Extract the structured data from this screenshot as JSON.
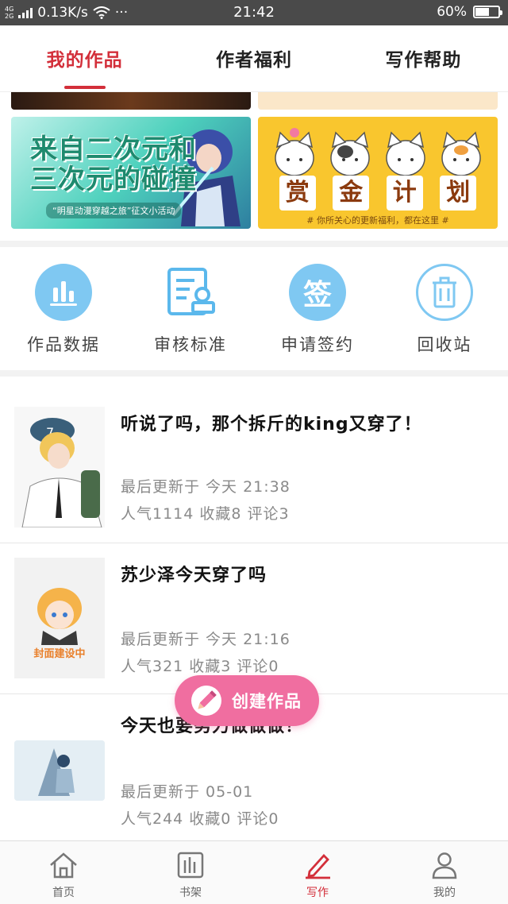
{
  "status_bar": {
    "network_top": "4G",
    "network_bottom": "2G",
    "speed": "0.13K/s",
    "more": "···",
    "time": "21:42",
    "battery": "60%",
    "battery_level": 0.6
  },
  "tabs": [
    {
      "label": "我的作品",
      "active": true
    },
    {
      "label": "作者福利",
      "active": false
    },
    {
      "label": "写作帮助",
      "active": false
    }
  ],
  "banners": {
    "left": {
      "title_line1": "来自二次元和",
      "title_line2": "三次元的碰撞",
      "subtitle": "“明星动漫穿越之旅”征文小活动"
    },
    "right": {
      "chars": [
        "赏",
        "金",
        "计",
        "划"
      ],
      "note": "# 你所关心的更新福利，都在这里 #"
    }
  },
  "quick_actions": [
    {
      "label": "作品数据",
      "icon": "bar-chart-icon"
    },
    {
      "label": "审核标准",
      "icon": "document-stamp-icon"
    },
    {
      "label": "申请签约",
      "icon": "sign-badge-icon",
      "icon_text": "签"
    },
    {
      "label": "回收站",
      "icon": "trash-icon"
    }
  ],
  "works": [
    {
      "title": "听说了吗，那个拆斤的king又穿了！",
      "updated": "最后更新于 今天 21:38",
      "stats": "人气1114 收藏8 评论3"
    },
    {
      "title": "苏少泽今天穿了吗",
      "updated": "最后更新于 今天 21:16",
      "stats": "人气321 收藏3 评论0",
      "cover_text": "封面建设中"
    },
    {
      "title": "今天也要努力做做做！",
      "updated": "最后更新于 05-01",
      "stats": "人气244 收藏0 评论0"
    }
  ],
  "fab": {
    "label": "创建作品"
  },
  "bottom_nav": [
    {
      "label": "首页",
      "icon": "home-icon"
    },
    {
      "label": "书架",
      "icon": "bookshelf-icon"
    },
    {
      "label": "写作",
      "icon": "pen-icon",
      "active": true
    },
    {
      "label": "我的",
      "icon": "user-icon"
    }
  ],
  "colors": {
    "accent": "#d32f3a",
    "fab": "#f06ea0",
    "icon_blue": "#5bb8ec"
  }
}
